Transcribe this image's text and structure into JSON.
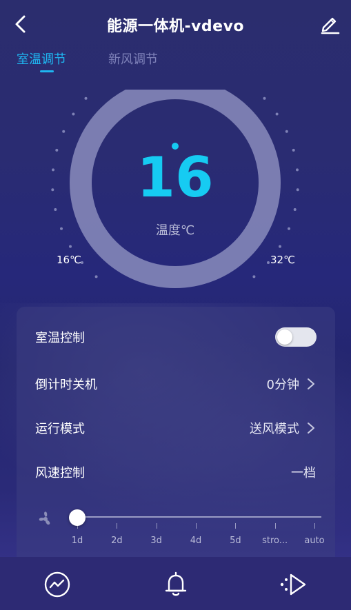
{
  "header": {
    "title": "能源一体机-vdevo",
    "back_icon": "chevron-left-icon",
    "edit_icon": "pencil-edit-icon"
  },
  "tabs": [
    {
      "label": "室温调节",
      "active": true
    },
    {
      "label": "新风调节",
      "active": false
    }
  ],
  "gauge": {
    "value": "16",
    "label": "温度℃",
    "min_label": "16℃",
    "max_label": "32℃",
    "min": 16,
    "max": 32,
    "current": 16
  },
  "settings": {
    "room_temp_control": {
      "label": "室温控制",
      "enabled": false
    },
    "timer_off": {
      "label": "倒计时关机",
      "value": "0分钟"
    },
    "run_mode": {
      "label": "运行模式",
      "value": "送风模式"
    },
    "fan_speed": {
      "label": "风速控制",
      "value": "一档"
    }
  },
  "fan_slider": {
    "labels": [
      "1d",
      "2d",
      "3d",
      "4d",
      "5d",
      "stro...",
      "auto"
    ],
    "selected_index": 0
  },
  "bottom_nav": [
    {
      "icon": "chart-trend-icon"
    },
    {
      "icon": "bell-icon"
    },
    {
      "icon": "play-triangle-icon"
    }
  ],
  "colors": {
    "accent": "#1fb6f1",
    "temp": "#16cbf2",
    "background": "#2a2c72"
  }
}
